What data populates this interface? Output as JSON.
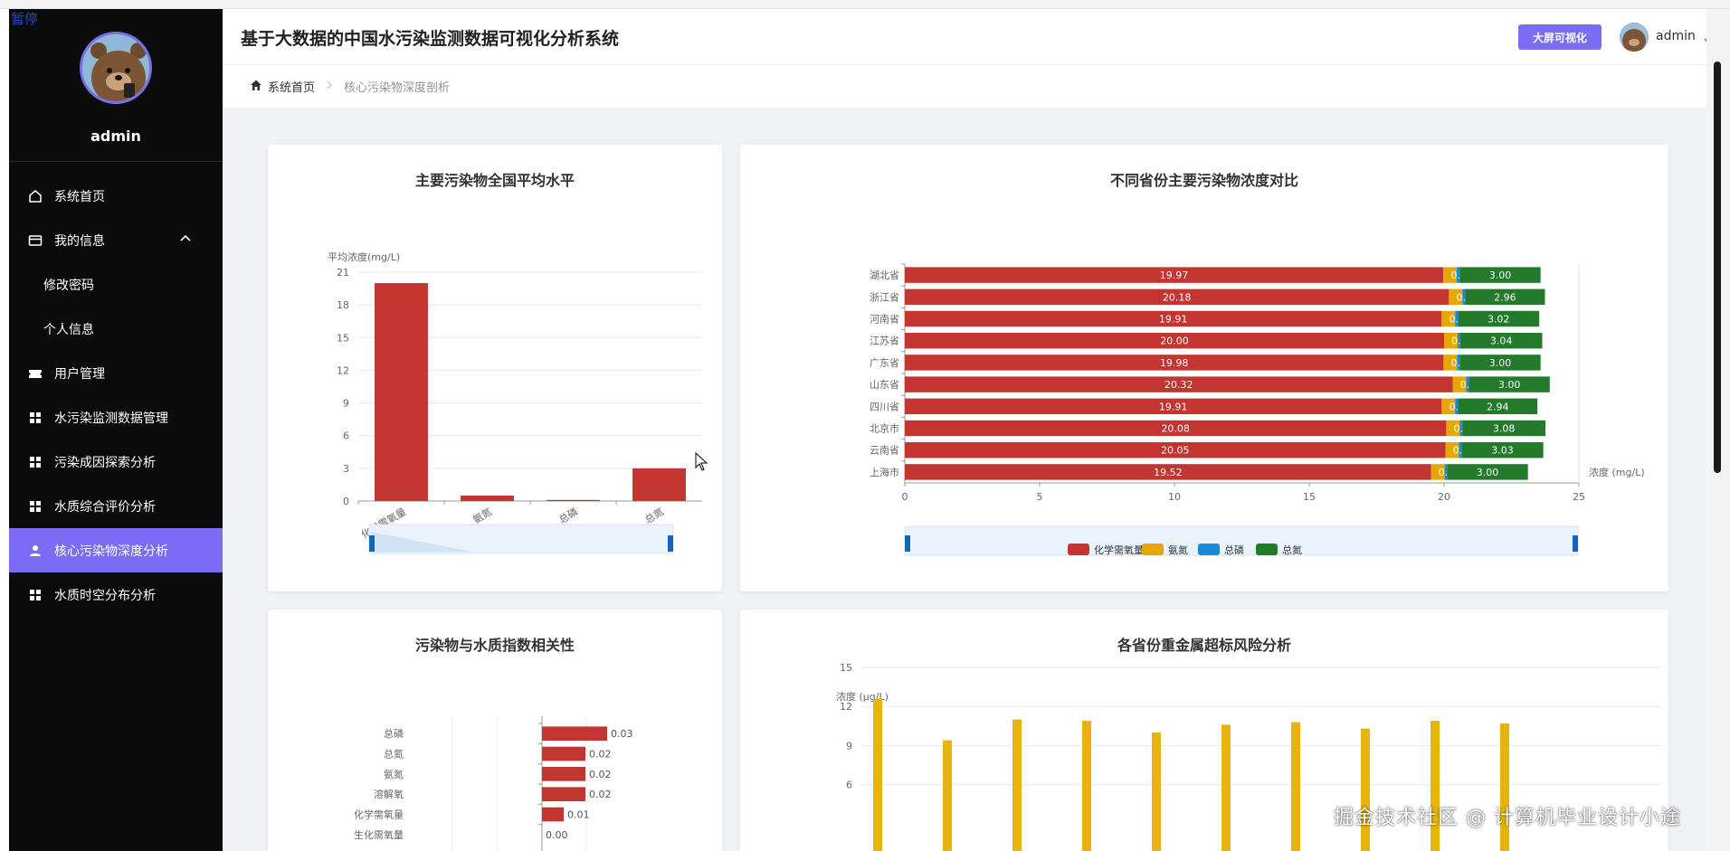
{
  "overlay": {
    "pause": "暂停",
    "watermark": "掘金技术社区 @ 计算机毕业设计小途"
  },
  "sidebar": {
    "username": "admin",
    "items": [
      {
        "label": "系统首页",
        "icon": "home-icon"
      },
      {
        "label": "我的信息",
        "icon": "card-icon"
      },
      {
        "label": "修改密码",
        "icon": ""
      },
      {
        "label": "个人信息",
        "icon": ""
      },
      {
        "label": "用户管理",
        "icon": "ticket-icon"
      },
      {
        "label": "水污染监测数据管理",
        "icon": "grid-icon"
      },
      {
        "label": "污染成因探索分析",
        "icon": "grid-icon"
      },
      {
        "label": "水质综合评价分析",
        "icon": "grid-icon"
      },
      {
        "label": "核心污染物深度分析",
        "icon": "user-icon"
      },
      {
        "label": "水质时空分布分析",
        "icon": "grid-icon"
      }
    ],
    "active_color": "#7b6cf6"
  },
  "header": {
    "title": "基于大数据的中国水污染监测数据可视化分析系统",
    "big_screen_label": "大屏可视化",
    "username": "admin"
  },
  "breadcrumb": {
    "home": "系统首页",
    "current": "核心污染物深度剖析"
  },
  "colors": {
    "cod": "#c23531",
    "nh3": "#e6a800",
    "tp": "#1a8ad4",
    "tn": "#237a2b",
    "heavy": "#e8b30e"
  },
  "chart_data": [
    {
      "type": "bar",
      "title": "主要污染物全国平均水平",
      "ylabel": "平均浓度(mg/L)",
      "categories": [
        "化学需氧量",
        "氨氮",
        "总磷",
        "总氮"
      ],
      "values": [
        20.0,
        0.5,
        0.1,
        3.0
      ],
      "ylim": [
        0,
        21
      ],
      "yticks": [
        "0",
        "3",
        "6",
        "9",
        "12",
        "15",
        "18",
        "21"
      ],
      "grid": true
    },
    {
      "type": "bar",
      "title": "不同省份主要污染物浓度对比",
      "xlabel": "浓度 (mg/L)",
      "categories": [
        "湖北省",
        "浙江省",
        "河南省",
        "江苏省",
        "广东省",
        "山东省",
        "四川省",
        "北京市",
        "云南省",
        "上海市"
      ],
      "series": [
        {
          "name": "化学需氧量",
          "values": [
            19.97,
            20.18,
            19.91,
            20.0,
            19.98,
            20.32,
            19.91,
            20.08,
            20.05,
            19.52
          ],
          "labels": [
            "19.97",
            "20.18",
            "19.91",
            "20.00",
            "19.98",
            "20.32",
            "19.91",
            "20.08",
            "20.05",
            "19.52"
          ]
        },
        {
          "name": "氨氮",
          "values": [
            0.5,
            0.5,
            0.5,
            0.5,
            0.5,
            0.5,
            0.5,
            0.5,
            0.5,
            0.5
          ]
        },
        {
          "name": "总磷",
          "values": [
            0.11,
            0.1,
            0.1,
            0.1,
            0.1,
            0.1,
            0.11,
            0.1,
            0.1,
            0.09
          ],
          "labels": [
            "0.11",
            "0.10",
            "0.10",
            "0.10",
            "0.10",
            "0.10",
            "0.11",
            "0.10",
            "0.10",
            "0.09"
          ]
        },
        {
          "name": "总氮",
          "values": [
            3.0,
            2.96,
            3.02,
            3.04,
            3.0,
            3.0,
            2.94,
            3.08,
            3.03,
            3.0
          ],
          "labels": [
            "3.00",
            "2.96",
            "3.02",
            "3.04",
            "3.00",
            "3.00",
            "2.94",
            "3.08",
            "3.03",
            "3.00"
          ]
        }
      ],
      "xlim": [
        0,
        25
      ],
      "xticks": [
        "0",
        "5",
        "10",
        "15",
        "20",
        "25"
      ],
      "legend": "bottom",
      "stacked": true
    },
    {
      "type": "bar",
      "title": "污染物与水质指数相关性",
      "categories": [
        "总磷",
        "总氮",
        "氨氮",
        "溶解氧",
        "化学需氧量",
        "生化需氧量"
      ],
      "values": [
        0.03,
        0.02,
        0.02,
        0.02,
        0.01,
        0.0
      ],
      "labels": [
        "0.03",
        "0.02",
        "0.02",
        "0.02",
        "0.01",
        "0.00"
      ]
    },
    {
      "type": "bar",
      "title": "各省份重金属超标风险分析",
      "ylabel": "浓度 (μg/L)",
      "values": [
        12.6,
        9.4,
        11.0,
        10.9,
        10.0,
        10.6,
        10.8,
        10.3,
        10.9,
        10.7
      ],
      "ylim": [
        0,
        15
      ],
      "yticks": [
        "6",
        "9",
        "12",
        "15"
      ]
    }
  ]
}
